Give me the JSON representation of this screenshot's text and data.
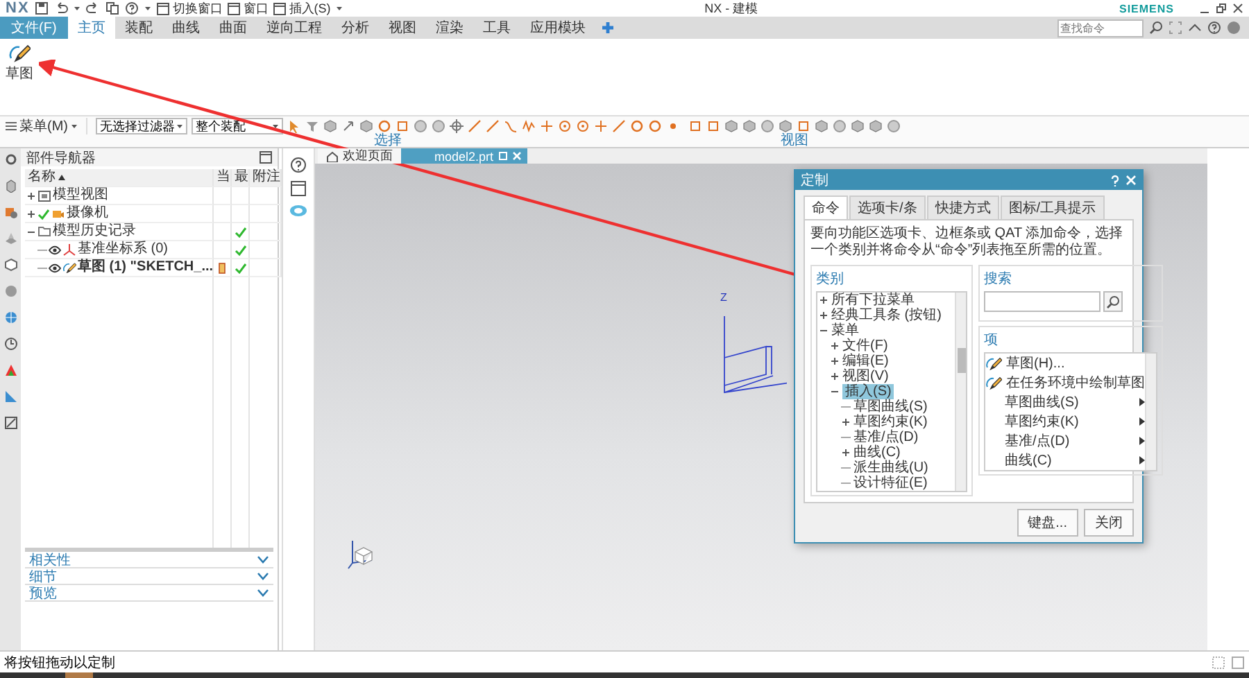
{
  "title_bar": {
    "logo": "NX",
    "quick_access": [
      {
        "label": "切换窗口"
      },
      {
        "label": "窗口"
      },
      {
        "label": "插入(S)"
      }
    ],
    "title": "NX - 建模",
    "brand": "SIEMENS"
  },
  "ribbon_tabs": [
    {
      "label": "文件(F)",
      "kind": "file",
      "selected": false
    },
    {
      "label": "主页",
      "kind": "tab",
      "selected": true
    },
    {
      "label": "装配",
      "kind": "tab",
      "selected": false
    },
    {
      "label": "曲线",
      "kind": "tab",
      "selected": false
    },
    {
      "label": "曲面",
      "kind": "tab",
      "selected": false
    },
    {
      "label": "逆向工程",
      "kind": "tab",
      "selected": false
    },
    {
      "label": "分析",
      "kind": "tab",
      "selected": false
    },
    {
      "label": "视图",
      "kind": "tab",
      "selected": false
    },
    {
      "label": "渲染",
      "kind": "tab",
      "selected": false
    },
    {
      "label": "工具",
      "kind": "tab",
      "selected": false
    },
    {
      "label": "应用模块",
      "kind": "tab",
      "selected": false
    }
  ],
  "command_search": {
    "placeholder": "查找命令"
  },
  "ribbon_commands": [
    {
      "label": "草图"
    }
  ],
  "selection_bar": {
    "menu": "菜单(M)",
    "type_filter": "无选择过滤器",
    "scope_filter": "整个装配",
    "group_labels": [
      "选择",
      "视图"
    ]
  },
  "navigator": {
    "title": "部件导航器",
    "columns": [
      "名称",
      "当",
      "最",
      "附注"
    ],
    "tree": [
      {
        "label": "模型视图",
        "kind": "views",
        "expanded": false,
        "latest": false
      },
      {
        "label": "摄像机",
        "kind": "cameras",
        "expanded": false,
        "checked": true,
        "latest": false
      },
      {
        "label": "模型历史记录",
        "kind": "history",
        "expanded": true,
        "latest": true,
        "children": [
          {
            "label": "基准坐标系 (0)",
            "kind": "datum",
            "visible": true,
            "latest": true,
            "current": false
          },
          {
            "label": "草图 (1) \"SKETCH_...",
            "kind": "sketch",
            "visible": true,
            "latest": true,
            "current": true
          }
        ]
      }
    ],
    "panels": [
      "相关性",
      "细节",
      "预览"
    ]
  },
  "document_tabs": [
    {
      "label": "欢迎页面",
      "kind": "home",
      "selected": false
    },
    {
      "label": "model2.prt",
      "kind": "part",
      "selected": true
    }
  ],
  "datum_labels": [
    "Z"
  ],
  "dialog": {
    "title": "定制",
    "tabs": [
      {
        "label": "命令",
        "selected": true
      },
      {
        "label": "选项卡/条",
        "selected": false
      },
      {
        "label": "快捷方式",
        "selected": false
      },
      {
        "label": "图标/工具提示",
        "selected": false
      }
    ],
    "description": "要向功能区选项卡、边框条或 QAT 添加命令，选择一个类别并将命令从“命令”列表拖至所需的位置。",
    "category_label": "类别",
    "categories": [
      {
        "label": "所有下拉菜单",
        "expanded": false,
        "selected": false
      },
      {
        "label": "经典工具条 (按钮)",
        "expanded": false,
        "selected": false
      },
      {
        "label": "菜单",
        "expanded": true,
        "selected": false,
        "children": [
          {
            "label": "文件(F)",
            "expanded": false,
            "selected": false
          },
          {
            "label": "编辑(E)",
            "expanded": false,
            "selected": false
          },
          {
            "label": "视图(V)",
            "expanded": false,
            "selected": false
          },
          {
            "label": "插入(S)",
            "expanded": true,
            "selected": true,
            "children": [
              {
                "label": "草图曲线(S)",
                "selected": false
              },
              {
                "label": "草图约束(K)",
                "expanded": false,
                "selected": false
              },
              {
                "label": "基准/点(D)",
                "selected": false
              },
              {
                "label": "曲线(C)",
                "expanded": false,
                "selected": false
              },
              {
                "label": "派生曲线(U)",
                "selected": false
              },
              {
                "label": "设计特征(E)",
                "selected": false
              }
            ]
          }
        ]
      }
    ],
    "search_label": "搜索",
    "items_label": "项",
    "items": [
      {
        "label": "草图(H)...",
        "kind": "command"
      },
      {
        "label": "在任务环境中绘制草图",
        "kind": "command"
      },
      {
        "label": "草图曲线(S)",
        "kind": "submenu"
      },
      {
        "label": "草图约束(K)",
        "kind": "submenu"
      },
      {
        "label": "基准/点(D)",
        "kind": "submenu"
      },
      {
        "label": "曲线(C)",
        "kind": "submenu"
      }
    ],
    "buttons": [
      "键盘...",
      "关闭"
    ]
  },
  "status_bar": {
    "message": "将按钮拖动以定制"
  }
}
